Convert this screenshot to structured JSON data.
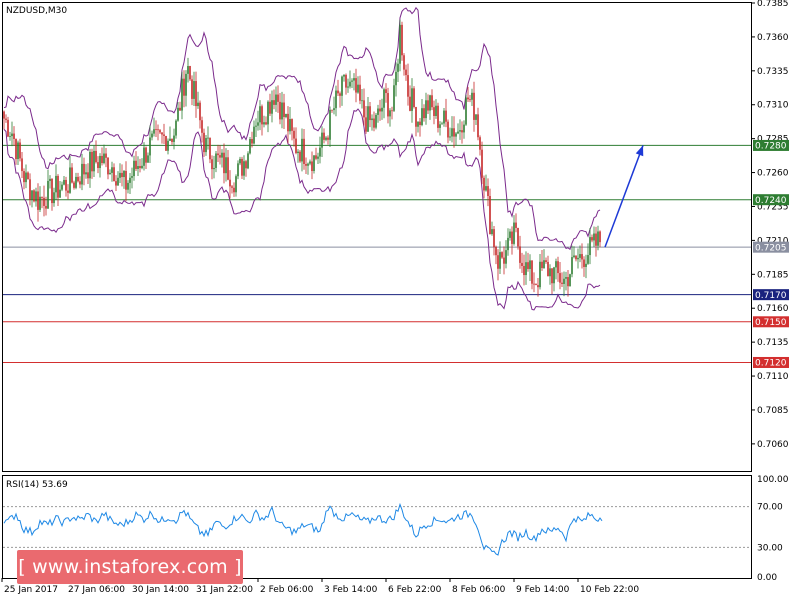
{
  "colors": {
    "candle_up": "#2e7d32",
    "candle_down": "#c62828",
    "bands": "#7b2a8c",
    "rsi_line": "#1e88e5",
    "arrow": "#1e3ad6",
    "support_dark": "#1a237e",
    "resistance_green": "#2e7d32",
    "red_level": "#d32f2f",
    "current_price": "#8a8fa0"
  },
  "chart_data": [
    {
      "type": "candlestick",
      "title": "NZDUSD,M30",
      "indicator": "Bollinger Bands",
      "ylim": [
        0.704,
        0.7385
      ],
      "y_ticks": [
        "0.7385",
        "0.7360",
        "0.7335",
        "0.7310",
        "0.7285",
        "0.7260",
        "0.7235",
        "0.7210",
        "0.7185",
        "0.7160",
        "0.7135",
        "0.7110",
        "0.7085",
        "0.7060"
      ],
      "x_ticks": [
        "25 Jan 2017",
        "27 Jan 06:00",
        "30 Jan 14:00",
        "31 Jan 22:00",
        "2 Feb 06:00",
        "3 Feb 14:00",
        "6 Feb 22:00",
        "8 Feb 06:00",
        "9 Feb 14:00",
        "10 Feb 22:00"
      ],
      "price_path": [
        [
          0,
          0.7305
        ],
        [
          12,
          0.729
        ],
        [
          25,
          0.7255
        ],
        [
          38,
          0.724
        ],
        [
          50,
          0.7245
        ],
        [
          62,
          0.725
        ],
        [
          75,
          0.7255
        ],
        [
          88,
          0.7265
        ],
        [
          100,
          0.727
        ],
        [
          112,
          0.7265
        ],
        [
          125,
          0.725
        ],
        [
          137,
          0.7265
        ],
        [
          150,
          0.728
        ],
        [
          162,
          0.7285
        ],
        [
          175,
          0.729
        ],
        [
          187,
          0.734
        ],
        [
          196,
          0.731
        ],
        [
          205,
          0.728
        ],
        [
          215,
          0.727
        ],
        [
          225,
          0.7265
        ],
        [
          235,
          0.7255
        ],
        [
          245,
          0.727
        ],
        [
          255,
          0.73
        ],
        [
          265,
          0.7305
        ],
        [
          275,
          0.732
        ],
        [
          285,
          0.73
        ],
        [
          295,
          0.728
        ],
        [
          305,
          0.7275
        ],
        [
          315,
          0.727
        ],
        [
          325,
          0.7285
        ],
        [
          335,
          0.731
        ],
        [
          345,
          0.7325
        ],
        [
          355,
          0.732
        ],
        [
          365,
          0.73
        ],
        [
          375,
          0.7295
        ],
        [
          385,
          0.7315
        ],
        [
          393,
          0.7305
        ],
        [
          400,
          0.7365
        ],
        [
          408,
          0.732
        ],
        [
          418,
          0.73
        ],
        [
          428,
          0.731
        ],
        [
          438,
          0.73
        ],
        [
          448,
          0.7295
        ],
        [
          458,
          0.729
        ],
        [
          468,
          0.7315
        ],
        [
          476,
          0.7305
        ],
        [
          483,
          0.726
        ],
        [
          490,
          0.7225
        ],
        [
          498,
          0.7195
        ],
        [
          506,
          0.72
        ],
        [
          515,
          0.7215
        ],
        [
          525,
          0.719
        ],
        [
          535,
          0.718
        ],
        [
          545,
          0.719
        ],
        [
          555,
          0.7185
        ],
        [
          565,
          0.718
        ],
        [
          575,
          0.7195
        ],
        [
          585,
          0.72
        ],
        [
          593,
          0.7205
        ],
        [
          600,
          0.721
        ]
      ],
      "levels": [
        {
          "value": 0.728,
          "label": "0.7280",
          "role": "resistance"
        },
        {
          "value": 0.724,
          "label": "0.7240",
          "role": "resistance"
        },
        {
          "value": 0.7205,
          "label": "0.7205",
          "role": "current"
        },
        {
          "value": 0.717,
          "label": "0.7170",
          "role": "support"
        },
        {
          "value": 0.715,
          "label": "0.7150",
          "role": "support"
        },
        {
          "value": 0.712,
          "label": "0.7120",
          "role": "support"
        }
      ],
      "projection": {
        "from": [
          605,
          0.7205
        ],
        "to": [
          643,
          0.728
        ]
      }
    },
    {
      "type": "line",
      "label": "RSI(14) 53.69",
      "ylim": [
        0,
        100
      ],
      "y_ticks": [
        "100.00",
        "70.00",
        "30.00",
        "0.00"
      ],
      "levels": [
        70,
        30
      ],
      "values": [
        [
          0,
          60
        ],
        [
          8,
          55
        ],
        [
          16,
          63
        ],
        [
          24,
          48
        ],
        [
          32,
          45
        ],
        [
          40,
          55
        ],
        [
          48,
          52
        ],
        [
          56,
          58
        ],
        [
          64,
          54
        ],
        [
          72,
          60
        ],
        [
          80,
          57
        ],
        [
          88,
          62
        ],
        [
          96,
          55
        ],
        [
          104,
          63
        ],
        [
          112,
          55
        ],
        [
          120,
          52
        ],
        [
          128,
          55
        ],
        [
          136,
          62
        ],
        [
          144,
          58
        ],
        [
          152,
          64
        ],
        [
          160,
          55
        ],
        [
          168,
          60
        ],
        [
          176,
          57
        ],
        [
          184,
          66
        ],
        [
          192,
          55
        ],
        [
          200,
          45
        ],
        [
          208,
          42
        ],
        [
          216,
          55
        ],
        [
          224,
          50
        ],
        [
          232,
          56
        ],
        [
          240,
          62
        ],
        [
          248,
          55
        ],
        [
          256,
          63
        ],
        [
          264,
          58
        ],
        [
          272,
          66
        ],
        [
          280,
          52
        ],
        [
          288,
          48
        ],
        [
          296,
          45
        ],
        [
          304,
          52
        ],
        [
          312,
          50
        ],
        [
          320,
          45
        ],
        [
          328,
          70
        ],
        [
          336,
          62
        ],
        [
          344,
          58
        ],
        [
          352,
          62
        ],
        [
          360,
          57
        ],
        [
          368,
          55
        ],
        [
          376,
          60
        ],
        [
          384,
          57
        ],
        [
          392,
          58
        ],
        [
          400,
          70
        ],
        [
          408,
          55
        ],
        [
          416,
          42
        ],
        [
          424,
          52
        ],
        [
          432,
          55
        ],
        [
          440,
          58
        ],
        [
          448,
          55
        ],
        [
          456,
          60
        ],
        [
          464,
          62
        ],
        [
          472,
          63
        ],
        [
          478,
          50
        ],
        [
          484,
          30
        ],
        [
          490,
          25
        ],
        [
          496,
          22
        ],
        [
          502,
          35
        ],
        [
          510,
          45
        ],
        [
          518,
          40
        ],
        [
          526,
          45
        ],
        [
          534,
          38
        ],
        [
          542,
          48
        ],
        [
          550,
          45
        ],
        [
          558,
          50
        ],
        [
          566,
          40
        ],
        [
          574,
          60
        ],
        [
          582,
          55
        ],
        [
          590,
          62
        ],
        [
          596,
          58
        ],
        [
          602,
          60
        ]
      ]
    }
  ],
  "watermark": "[  www.instaforex.com  ]"
}
